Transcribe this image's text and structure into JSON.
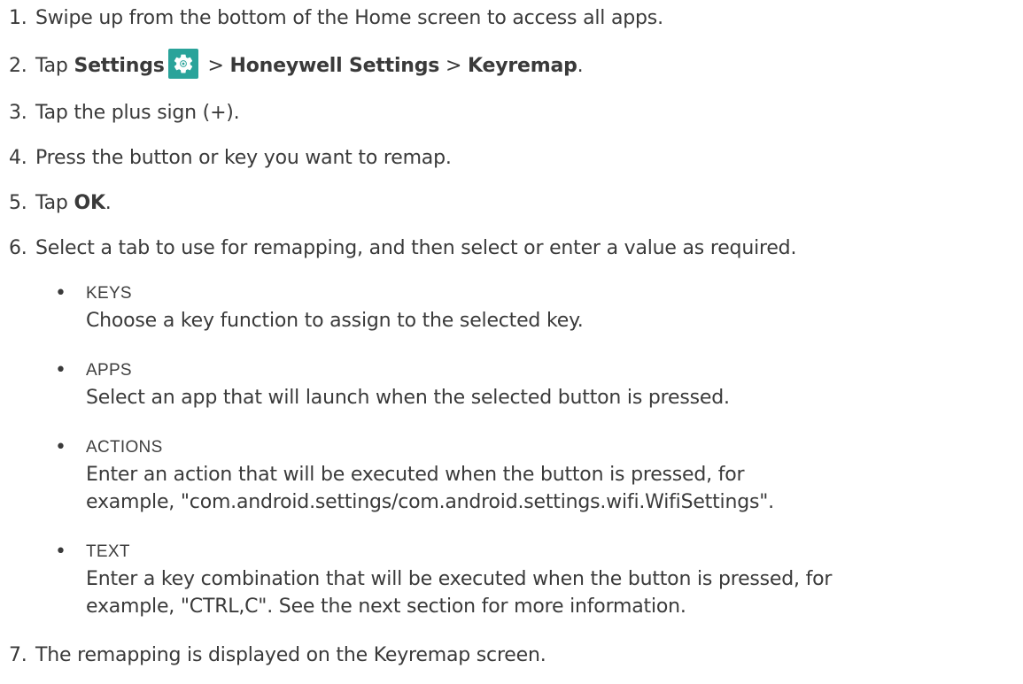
{
  "steps": [
    {
      "num": "1.",
      "text": "Swipe up from the bottom of the Home screen to access all apps."
    },
    {
      "num": "2.",
      "pre": "Tap ",
      "settings": "Settings",
      "sep1": " > ",
      "honeywell": "Honeywell Settings",
      "sep2": " > ",
      "keyremap": "Keyremap",
      "end": "."
    },
    {
      "num": "3.",
      "text": "Tap the plus sign (+)."
    },
    {
      "num": "4.",
      "text": "Press the button or key you want to remap."
    },
    {
      "num": "5.",
      "pre": "Tap ",
      "ok": "OK",
      "end": "."
    },
    {
      "num": "6.",
      "text": "Select a tab to use for remapping, and then select or enter a value as required."
    },
    {
      "num": "7.",
      "text": "The remapping is displayed on the Keyremap screen."
    }
  ],
  "options": [
    {
      "term": "KEYS",
      "desc": [
        "Choose a key function to assign to the selected key."
      ]
    },
    {
      "term": "APPS",
      "desc": [
        "Select an app that will launch when the selected button is pressed."
      ]
    },
    {
      "term": "ACTIONS",
      "desc": [
        "Enter an action that will be executed when the button is pressed, for",
        "example, \"com.android.settings/com.android.settings.wifi.WifiSettings\"."
      ]
    },
    {
      "term": "TEXT",
      "desc": [
        "Enter a key combination that will be executed when the button is pressed, for",
        "example, \"CTRL,C\". See the next section for more information."
      ]
    }
  ],
  "bullet_char": "•",
  "icon": {
    "name": "settings-gear-icon",
    "color": "#2aa39a"
  }
}
